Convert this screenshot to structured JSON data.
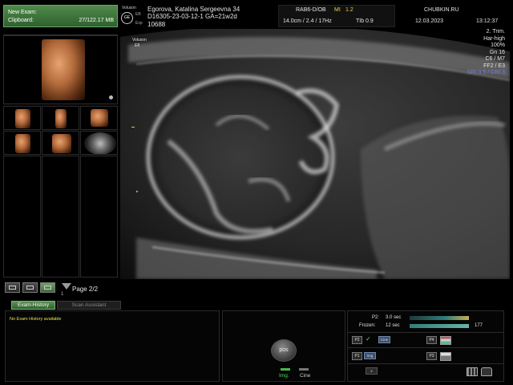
{
  "clipboard": {
    "new_exam_label": "New Exam:",
    "clipboard_label": "Clipboard:",
    "storage": "27/122.17 MB"
  },
  "paging": {
    "page_label": "Page 2/2",
    "page_index": "1"
  },
  "header": {
    "brand": "Voluson",
    "eb": "EB",
    "exp": "Exp",
    "patient_name": "Egorova, Katalina Sergeevna 34",
    "patient_id": "D16305-23-03-12-1  GA=21w2d",
    "patient_number": "10688",
    "probe": "RAB6-D/OB",
    "mi_label": "MI",
    "mi_value": "1.2",
    "depth_info": "14.0cm / 2.4 / 17Hz",
    "tib": "TIb  0.9",
    "site": "CHUBKIN.RU",
    "date": "12.03.2023",
    "time": "13:12:37"
  },
  "image": {
    "eb_small": "Voluson",
    "eb_small2": "E8",
    "depth_marker": "▸",
    "params": [
      "2. Trim.",
      "Har-high",
      "100%",
      "Gn 16",
      "C6 / M7",
      "FF2 / E3",
      "SRI II 5 / CRI 3"
    ]
  },
  "bottom": {
    "tab_history": "Exam-History",
    "tab_scan_assistant": "Scan Assistant",
    "history_message": "No Exam History available",
    "pos_label": "pos",
    "img_label": "Img.",
    "cine_label": "Cine",
    "p2_label": "P2:",
    "p2_value": "3.0 sec",
    "frozen_label": "Frozen:",
    "frozen_value": "12 sec",
    "frozen_count": "177",
    "btn_p2": "P2",
    "btn_p1": "P1",
    "btn_p4": "P4",
    "btn_p3": "P3",
    "chip_cine": "Cine",
    "chip_img": "Img",
    "chip_x": "x"
  },
  "colors": {
    "accent_green": "#4f8a4a",
    "warning_yellow": "#e9d245",
    "param_blue": "#6d7df2"
  }
}
